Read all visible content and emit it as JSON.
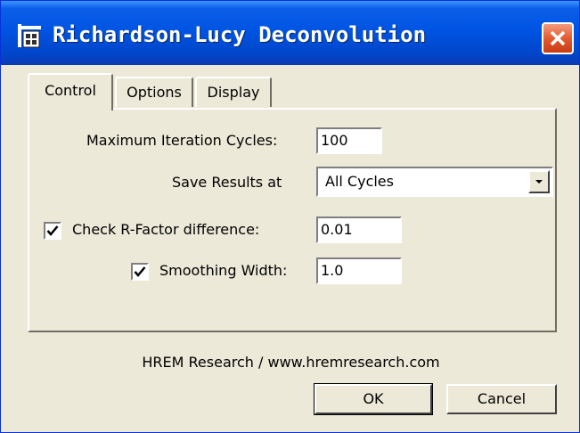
{
  "window": {
    "title": "Richardson-Lucy Deconvolution",
    "icon": "app-icon",
    "close_icon": "close-icon"
  },
  "tabs": [
    {
      "label": "Control",
      "active": true
    },
    {
      "label": "Options",
      "active": false
    },
    {
      "label": "Display",
      "active": false
    }
  ],
  "control": {
    "max_iterations": {
      "label": "Maximum Iteration Cycles:",
      "value": "100"
    },
    "save_results": {
      "label": "Save Results at",
      "selected": "All Cycles"
    },
    "rfactor": {
      "label": "Check R-Factor difference:",
      "checked": true,
      "value": "0.01"
    },
    "smoothing": {
      "label": "Smoothing Width:",
      "checked": true,
      "value": "1.0"
    }
  },
  "footer": {
    "credit": "HREM Research / www.hremresearch.com"
  },
  "buttons": {
    "ok": "OK",
    "cancel": "Cancel"
  },
  "colors": {
    "titlebar": "#0054e3",
    "dialog": "#ece9d8",
    "close": "#e35b30"
  }
}
